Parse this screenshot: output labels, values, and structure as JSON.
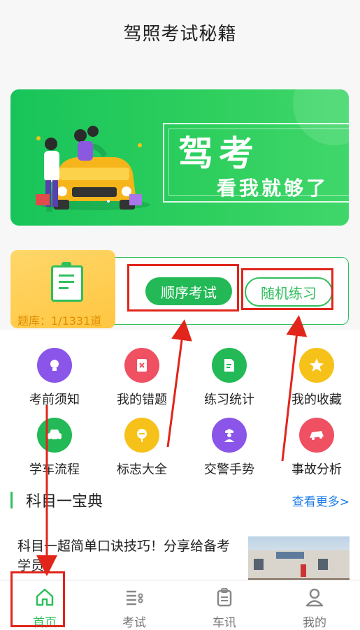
{
  "header": {
    "title": "驾照考试秘籍"
  },
  "banner": {
    "headline": "驾考",
    "subline": "看我就够了"
  },
  "practice": {
    "bank_label": "题库：1/1331道",
    "sequential_button": "顺序考试",
    "random_button": "随机练习"
  },
  "features": [
    {
      "label": "考前须知",
      "icon": "lightbulb-icon",
      "color": "#8a55e8"
    },
    {
      "label": "我的错题",
      "icon": "wrong-notebook-icon",
      "color": "#ef5062"
    },
    {
      "label": "练习统计",
      "icon": "document-edit-icon",
      "color": "#23b956"
    },
    {
      "label": "我的收藏",
      "icon": "star-icon",
      "color": "#f6c21a"
    },
    {
      "label": "学车流程",
      "icon": "car-icon",
      "color": "#23b956"
    },
    {
      "label": "标志大全",
      "icon": "sign-icon",
      "color": "#f6c21a"
    },
    {
      "label": "交警手势",
      "icon": "police-icon",
      "color": "#8a55e8"
    },
    {
      "label": "事故分析",
      "icon": "crash-car-icon",
      "color": "#ef5062"
    }
  ],
  "section": {
    "title": "科目一宝典",
    "more": "查看更多>"
  },
  "article": {
    "text": "科目一超简单口诀技巧！分享给备考学员！"
  },
  "tabs": [
    {
      "label": "首页",
      "icon": "home-icon"
    },
    {
      "label": "考试",
      "icon": "list-icon"
    },
    {
      "label": "车讯",
      "icon": "clipboard-icon"
    },
    {
      "label": "我的",
      "icon": "person-icon"
    }
  ],
  "colors": {
    "brand_green": "#23b956",
    "annotation_red": "#e1251b",
    "link_blue": "#1b7be8"
  }
}
